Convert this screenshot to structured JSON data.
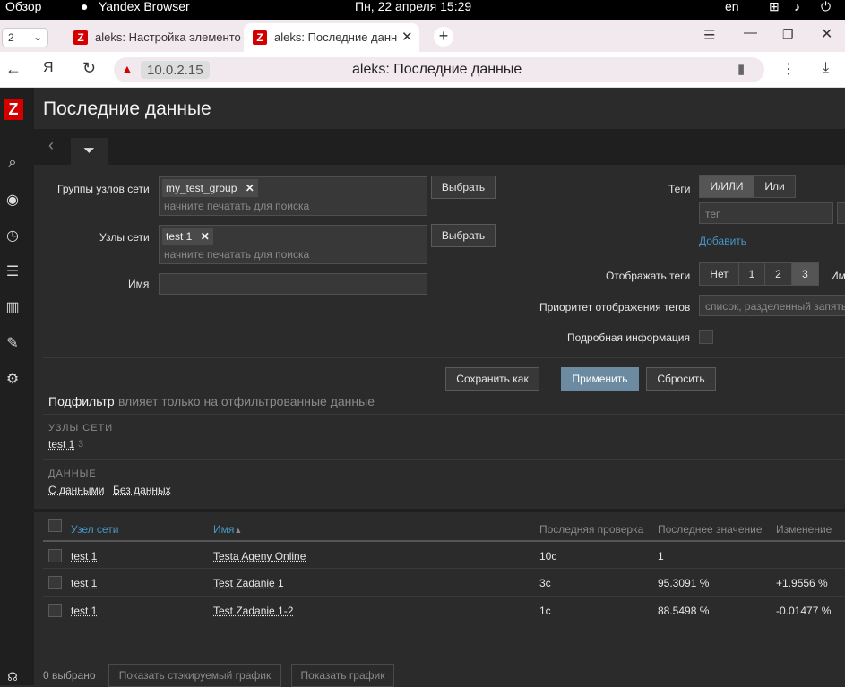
{
  "system": {
    "overview": "Обзор",
    "app": "Yandex Browser",
    "datetime": "Пн, 22 апреля  15:29",
    "lang": "en"
  },
  "browser": {
    "tab_count": "2",
    "tabs": [
      {
        "title": "aleks: Настройка элементо"
      },
      {
        "title": "aleks: Последние данн"
      }
    ],
    "address": "10.0.2.15",
    "page_title": "aleks: Последние данные"
  },
  "page": {
    "title": "Последние данные"
  },
  "filter": {
    "host_groups_label": "Группы узлов сети",
    "host_group_chip": "my_test_group",
    "search_placeholder": "начните печатать для поиска",
    "select_label": "Выбрать",
    "hosts_label": "Узлы сети",
    "host_chip": "test 1",
    "name_label": "Имя",
    "tags_label": "Теги",
    "tags_and_or": "И/ИЛИ",
    "tags_or": "Или",
    "tag_placeholder": "тег",
    "add_label": "Добавить",
    "show_tags_label": "Отображать теги",
    "show_tags_options": [
      "Нет",
      "1",
      "2",
      "3"
    ],
    "show_tags_extra": "Им",
    "priority_label": "Приоритет отображения тегов",
    "priority_placeholder": "список, разделенный запятыми",
    "details_label": "Подробная информация",
    "save_as": "Сохранить как",
    "apply": "Применить",
    "reset": "Сбросить"
  },
  "subfilter": {
    "title": "Подфильтр",
    "hint": "влияет только на отфильтрованные данные",
    "hosts_heading": "УЗЛЫ СЕТИ",
    "host_item": "test 1",
    "host_count": "3",
    "data_heading": "ДАННЫЕ",
    "with_data": "С данными",
    "without_data": "Без данных"
  },
  "table": {
    "headers": {
      "host": "Узел сети",
      "name": "Имя",
      "last_check": "Последняя проверка",
      "last_value": "Последнее значение",
      "change": "Изменение"
    },
    "rows": [
      {
        "host": "test 1",
        "name": "Testa Ageny Online",
        "last_check": "10с",
        "last_value": "1",
        "change": ""
      },
      {
        "host": "test 1",
        "name": "Test Zadanie 1",
        "last_check": "3с",
        "last_value": "95.3091 %",
        "change": "+1.9556 %"
      },
      {
        "host": "test 1",
        "name": "Test Zadanie 1-2",
        "last_check": "1с",
        "last_value": "88.5498 %",
        "change": "-0.01477 %"
      }
    ]
  },
  "footer": {
    "selected": "0 выбрано",
    "stacked_graph": "Показать стэкируемый график",
    "graph": "Показать график"
  },
  "colors": {
    "zabbix_red": "#d40000",
    "accent_blue": "#4796c4"
  }
}
